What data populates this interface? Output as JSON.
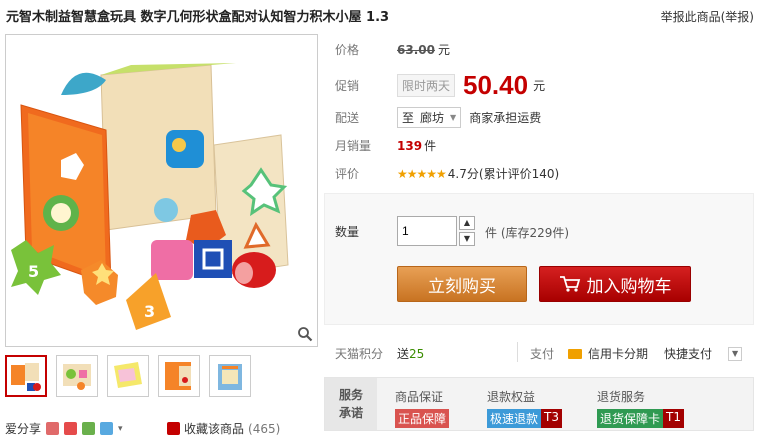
{
  "product": {
    "title": "元智木制益智慧盒玩具 数字几何形状盒配对认知智力积木小屋 1.3",
    "report_link": "举报此商品(举报)"
  },
  "price": {
    "label": "价格",
    "original": "63.00",
    "currency": "元"
  },
  "promo": {
    "label": "促销",
    "tag": "限时两天",
    "price": "50.40",
    "currency": "元"
  },
  "delivery": {
    "label": "配送",
    "to": "至",
    "location": "廊坊",
    "note": "商家承担运费"
  },
  "monthly_sales": {
    "label": "月销量",
    "value": "139",
    "unit": "件"
  },
  "rating": {
    "label": "评价",
    "stars": "★★★★★",
    "score": "4.7分",
    "summary": "(累计评价140)"
  },
  "purchase": {
    "qty_label": "数量",
    "qty_value": "1",
    "unit": "件",
    "stock": "(库存229件)",
    "buy_now": "立刻购买",
    "add_to_cart": "加入购物车",
    "buy_color": "#d7852f",
    "cart_color": "#c40000"
  },
  "points": {
    "label": "天猫积分",
    "prefix": "送",
    "value": "25"
  },
  "payment": {
    "label": "支付",
    "option1": "信用卡分期",
    "option2": "快捷支付"
  },
  "services": {
    "head_line1": "服务",
    "head_line2": "承诺",
    "items": [
      {
        "title": "商品保证",
        "tag": "正品保障",
        "tag_color": "#d9534f",
        "extra": ""
      },
      {
        "title": "退款权益",
        "tag": "极速退款",
        "tag_color": "#3c9ad8",
        "extra": "T3"
      },
      {
        "title": "退货服务",
        "tag": "退货保障卡",
        "tag_color": "#2f9a52",
        "extra": "T1"
      }
    ]
  },
  "share": {
    "label": "爱分享"
  },
  "favorite": {
    "label": "收藏该商品",
    "count": "(465)"
  }
}
